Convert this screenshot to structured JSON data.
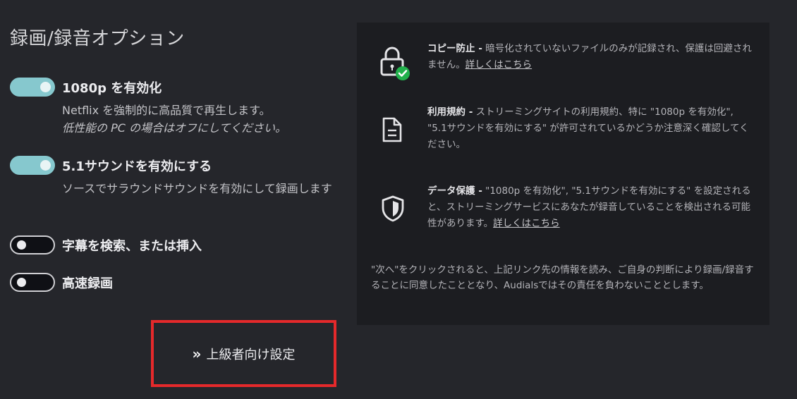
{
  "title": "録画/録音オプション",
  "options": [
    {
      "label": "1080p を有効化",
      "state": "on",
      "description": "Netflix を強制的に高品質で再生します。",
      "description_em": "低性能の PC の場合はオフにしてください。"
    },
    {
      "label": "5.1サウンドを有効にする",
      "state": "on",
      "description": "ソースでサラウンドサウンドを有効にして録画します"
    },
    {
      "label": "字幕を検索、または挿入",
      "state": "off"
    },
    {
      "label": "高速録画",
      "state": "off"
    }
  ],
  "advanced_button": {
    "chevron": "»",
    "label": "上級者向け設定"
  },
  "info": {
    "items": [
      {
        "icon": "lock-check-icon",
        "head": "コピー防止 -",
        "text": " 暗号化されていないファイルのみが記録され、保護は回避されません。",
        "link": "詳しくはこちら"
      },
      {
        "icon": "document-icon",
        "head": "利用規約 -",
        "text": " ストリーミングサイトの利用規約、特に \"1080p を有効化\", \"5.1サウンドを有効にする\" が許可されているかどうか注意深く確認してください。"
      },
      {
        "icon": "shield-icon",
        "head": "データ保護 -",
        "text": " \"1080p を有効化\", \"5.1サウンドを有効にする\" を設定されると、ストリーミングサービスにあなたが録音していることを検出される可能性があります。",
        "link": "詳しくはこちら"
      }
    ],
    "footnote": "\"次へ\"をクリックされると、上記リンク先の情報を読み、ご自身の判断により録画/録音することに同意したこととなり、Audialsではその責任を負わないこととします。"
  },
  "colors": {
    "background": "#25262b",
    "panel": "#1c1d21",
    "toggle_on": "#86c8ce",
    "highlight_border": "#e5292b",
    "check_badge": "#22b14c"
  }
}
